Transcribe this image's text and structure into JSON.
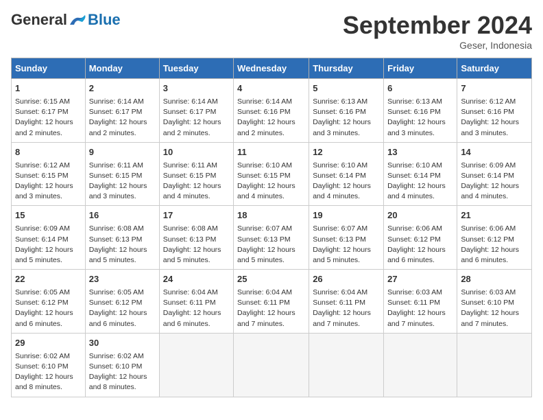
{
  "logo": {
    "general": "General",
    "blue": "Blue"
  },
  "title": "September 2024",
  "location": "Geser, Indonesia",
  "days_header": [
    "Sunday",
    "Monday",
    "Tuesday",
    "Wednesday",
    "Thursday",
    "Friday",
    "Saturday"
  ],
  "weeks": [
    [
      {
        "day": "1",
        "info": "Sunrise: 6:15 AM\nSunset: 6:17 PM\nDaylight: 12 hours\nand 2 minutes."
      },
      {
        "day": "2",
        "info": "Sunrise: 6:14 AM\nSunset: 6:17 PM\nDaylight: 12 hours\nand 2 minutes."
      },
      {
        "day": "3",
        "info": "Sunrise: 6:14 AM\nSunset: 6:17 PM\nDaylight: 12 hours\nand 2 minutes."
      },
      {
        "day": "4",
        "info": "Sunrise: 6:14 AM\nSunset: 6:16 PM\nDaylight: 12 hours\nand 2 minutes."
      },
      {
        "day": "5",
        "info": "Sunrise: 6:13 AM\nSunset: 6:16 PM\nDaylight: 12 hours\nand 3 minutes."
      },
      {
        "day": "6",
        "info": "Sunrise: 6:13 AM\nSunset: 6:16 PM\nDaylight: 12 hours\nand 3 minutes."
      },
      {
        "day": "7",
        "info": "Sunrise: 6:12 AM\nSunset: 6:16 PM\nDaylight: 12 hours\nand 3 minutes."
      }
    ],
    [
      {
        "day": "8",
        "info": "Sunrise: 6:12 AM\nSunset: 6:15 PM\nDaylight: 12 hours\nand 3 minutes."
      },
      {
        "day": "9",
        "info": "Sunrise: 6:11 AM\nSunset: 6:15 PM\nDaylight: 12 hours\nand 3 minutes."
      },
      {
        "day": "10",
        "info": "Sunrise: 6:11 AM\nSunset: 6:15 PM\nDaylight: 12 hours\nand 4 minutes."
      },
      {
        "day": "11",
        "info": "Sunrise: 6:10 AM\nSunset: 6:15 PM\nDaylight: 12 hours\nand 4 minutes."
      },
      {
        "day": "12",
        "info": "Sunrise: 6:10 AM\nSunset: 6:14 PM\nDaylight: 12 hours\nand 4 minutes."
      },
      {
        "day": "13",
        "info": "Sunrise: 6:10 AM\nSunset: 6:14 PM\nDaylight: 12 hours\nand 4 minutes."
      },
      {
        "day": "14",
        "info": "Sunrise: 6:09 AM\nSunset: 6:14 PM\nDaylight: 12 hours\nand 4 minutes."
      }
    ],
    [
      {
        "day": "15",
        "info": "Sunrise: 6:09 AM\nSunset: 6:14 PM\nDaylight: 12 hours\nand 5 minutes."
      },
      {
        "day": "16",
        "info": "Sunrise: 6:08 AM\nSunset: 6:13 PM\nDaylight: 12 hours\nand 5 minutes."
      },
      {
        "day": "17",
        "info": "Sunrise: 6:08 AM\nSunset: 6:13 PM\nDaylight: 12 hours\nand 5 minutes."
      },
      {
        "day": "18",
        "info": "Sunrise: 6:07 AM\nSunset: 6:13 PM\nDaylight: 12 hours\nand 5 minutes."
      },
      {
        "day": "19",
        "info": "Sunrise: 6:07 AM\nSunset: 6:13 PM\nDaylight: 12 hours\nand 5 minutes."
      },
      {
        "day": "20",
        "info": "Sunrise: 6:06 AM\nSunset: 6:12 PM\nDaylight: 12 hours\nand 6 minutes."
      },
      {
        "day": "21",
        "info": "Sunrise: 6:06 AM\nSunset: 6:12 PM\nDaylight: 12 hours\nand 6 minutes."
      }
    ],
    [
      {
        "day": "22",
        "info": "Sunrise: 6:05 AM\nSunset: 6:12 PM\nDaylight: 12 hours\nand 6 minutes."
      },
      {
        "day": "23",
        "info": "Sunrise: 6:05 AM\nSunset: 6:12 PM\nDaylight: 12 hours\nand 6 minutes."
      },
      {
        "day": "24",
        "info": "Sunrise: 6:04 AM\nSunset: 6:11 PM\nDaylight: 12 hours\nand 6 minutes."
      },
      {
        "day": "25",
        "info": "Sunrise: 6:04 AM\nSunset: 6:11 PM\nDaylight: 12 hours\nand 7 minutes."
      },
      {
        "day": "26",
        "info": "Sunrise: 6:04 AM\nSunset: 6:11 PM\nDaylight: 12 hours\nand 7 minutes."
      },
      {
        "day": "27",
        "info": "Sunrise: 6:03 AM\nSunset: 6:11 PM\nDaylight: 12 hours\nand 7 minutes."
      },
      {
        "day": "28",
        "info": "Sunrise: 6:03 AM\nSunset: 6:10 PM\nDaylight: 12 hours\nand 7 minutes."
      }
    ],
    [
      {
        "day": "29",
        "info": "Sunrise: 6:02 AM\nSunset: 6:10 PM\nDaylight: 12 hours\nand 8 minutes."
      },
      {
        "day": "30",
        "info": "Sunrise: 6:02 AM\nSunset: 6:10 PM\nDaylight: 12 hours\nand 8 minutes."
      },
      {
        "day": "",
        "info": ""
      },
      {
        "day": "",
        "info": ""
      },
      {
        "day": "",
        "info": ""
      },
      {
        "day": "",
        "info": ""
      },
      {
        "day": "",
        "info": ""
      }
    ]
  ]
}
